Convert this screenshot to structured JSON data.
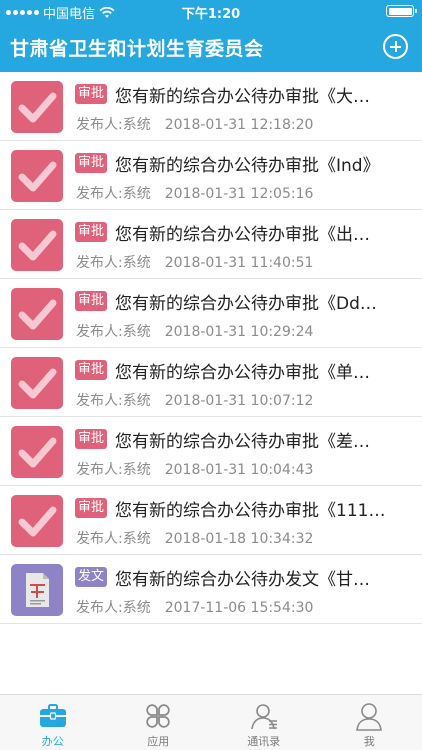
{
  "status_bar": {
    "carrier": "中国电信",
    "time": "下午1:20"
  },
  "header": {
    "title": "甘肃省卫生和计划生育委员会",
    "add_icon": "plus-circle-icon"
  },
  "colors": {
    "accent": "#25a8e0",
    "approve_tag": "#e0627a",
    "doc_tag": "#8e83c6"
  },
  "items": [
    {
      "tag": "审批",
      "type": "approve",
      "title": "您有新的综合办公待办审批《大…",
      "publisher": "发布人:系统",
      "time": "2018-01-31 12:18:20"
    },
    {
      "tag": "审批",
      "type": "approve",
      "title": "您有新的综合办公待办审批《Ind》",
      "publisher": "发布人:系统",
      "time": "2018-01-31 12:05:16"
    },
    {
      "tag": "审批",
      "type": "approve",
      "title": "您有新的综合办公待办审批《出…",
      "publisher": "发布人:系统",
      "time": "2018-01-31 11:40:51"
    },
    {
      "tag": "审批",
      "type": "approve",
      "title": "您有新的综合办公待办审批《Dd…",
      "publisher": "发布人:系统",
      "time": "2018-01-31 10:29:24"
    },
    {
      "tag": "审批",
      "type": "approve",
      "title": "您有新的综合办公待办审批《单…",
      "publisher": "发布人:系统",
      "time": "2018-01-31 10:07:12"
    },
    {
      "tag": "审批",
      "type": "approve",
      "title": "您有新的综合办公待办审批《差…",
      "publisher": "发布人:系统",
      "time": "2018-01-31 10:04:43"
    },
    {
      "tag": "审批",
      "type": "approve",
      "title": "您有新的综合办公待办审批《111…",
      "publisher": "发布人:系统",
      "time": "2018-01-18 10:34:32"
    },
    {
      "tag": "发文",
      "type": "doc",
      "title": "您有新的综合办公待办发文《甘…",
      "publisher": "发布人:系统",
      "time": "2017-11-06 15:54:30"
    }
  ],
  "tabs": [
    {
      "label": "办公",
      "icon": "briefcase-icon",
      "active": true
    },
    {
      "label": "应用",
      "icon": "apps-icon",
      "active": false
    },
    {
      "label": "通讯录",
      "icon": "contacts-icon",
      "active": false
    },
    {
      "label": "我",
      "icon": "person-icon",
      "active": false
    }
  ]
}
